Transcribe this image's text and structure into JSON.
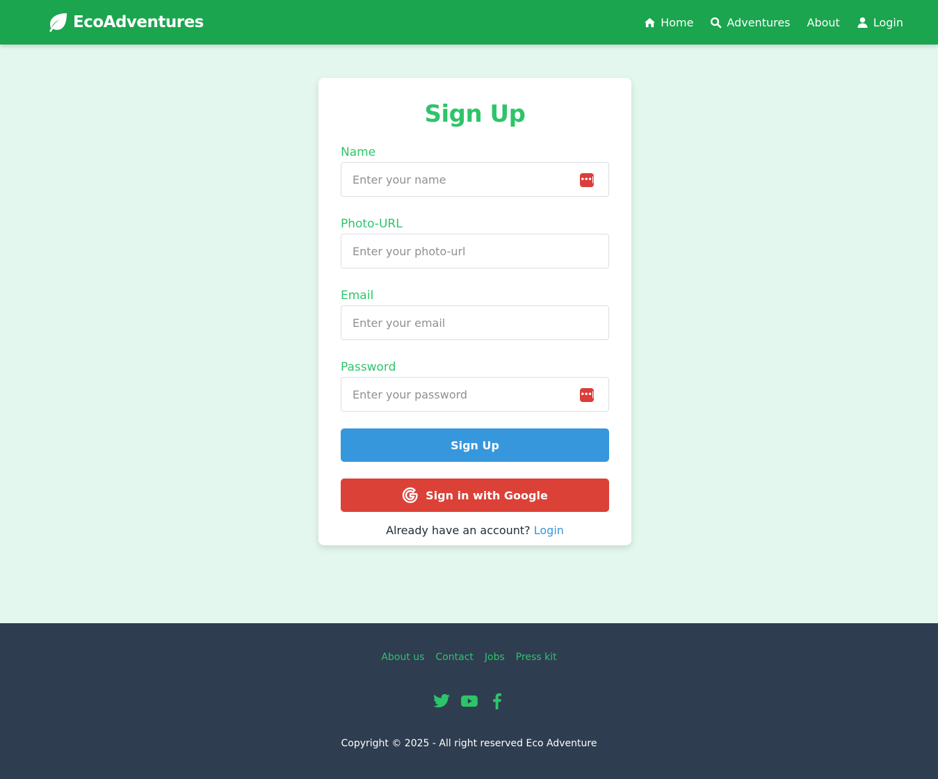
{
  "brand": {
    "name": "EcoAdventures",
    "logo_icon": "leaf-icon"
  },
  "nav": {
    "items": [
      {
        "label": "Home",
        "icon": "home-icon"
      },
      {
        "label": "Adventures",
        "icon": "search-icon"
      },
      {
        "label": "About",
        "icon": ""
      },
      {
        "label": "Login",
        "icon": "user-icon"
      }
    ]
  },
  "form": {
    "title": "Sign Up",
    "fields": [
      {
        "label": "Name",
        "placeholder": "Enter your name",
        "value": ""
      },
      {
        "label": "Photo-URL",
        "placeholder": "Enter your photo-url",
        "value": ""
      },
      {
        "label": "Email",
        "placeholder": "Enter your email",
        "value": ""
      },
      {
        "label": "Password",
        "placeholder": "Enter your password",
        "value": ""
      }
    ],
    "signup_button": "Sign Up",
    "google_button": "Sign in with Google",
    "login_prompt": "Already have an account?",
    "login_link": "Login"
  },
  "footer": {
    "links": [
      "About us",
      "Contact",
      "Jobs",
      "Press kit"
    ],
    "socials": [
      "twitter-icon",
      "youtube-icon",
      "facebook-icon"
    ],
    "copyright": "Copyright © 2025 - All right reserved Eco Adventure"
  },
  "colors": {
    "nav_bg": "#1aa54e",
    "page_bg": "#e3f7ee",
    "accent_green": "#2ec46a",
    "signup_blue": "#3797dc",
    "google_red": "#db4137",
    "footer_bg": "#2e3d50"
  }
}
